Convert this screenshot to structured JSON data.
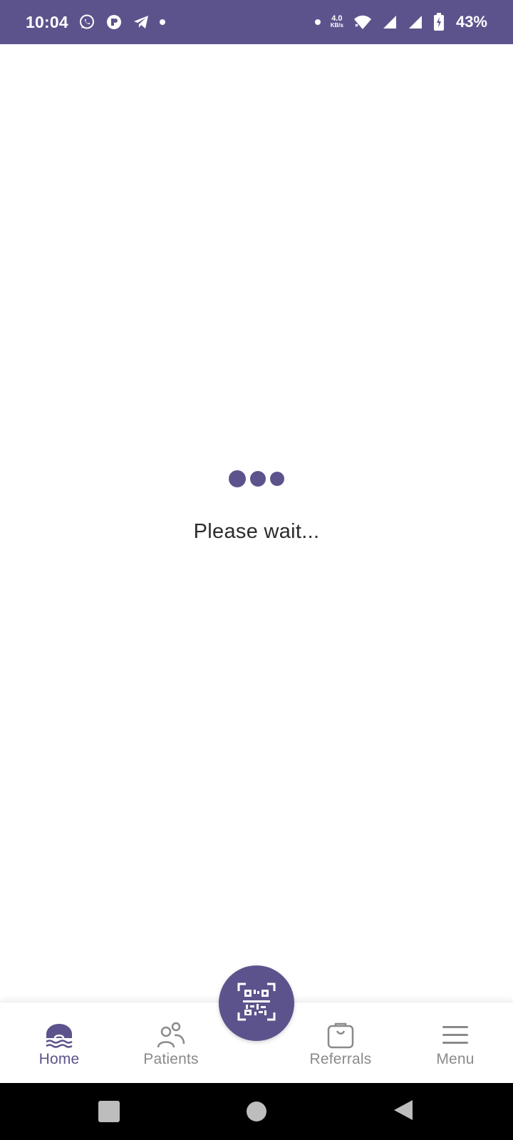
{
  "status_bar": {
    "time": "10:04",
    "net_speed_value": "4.0",
    "net_speed_unit": "KB/s",
    "battery_percent": "43%",
    "bar_color": "#5d538c",
    "left_icons": [
      "whatsapp-icon",
      "app-icon",
      "telegram-icon",
      "notification-dot-icon"
    ],
    "right_icons": [
      "dot-icon",
      "wifi-icon",
      "signal-icon",
      "signal-icon",
      "battery-charging-icon"
    ]
  },
  "loading": {
    "text": "Please wait..."
  },
  "bottom_nav": {
    "items": [
      {
        "label": "Home",
        "icon": "home-icon",
        "active": true
      },
      {
        "label": "Patients",
        "icon": "patients-icon",
        "active": false
      },
      {
        "label": "Referrals",
        "icon": "referrals-icon",
        "active": false
      },
      {
        "label": "Menu",
        "icon": "menu-icon",
        "active": false
      }
    ],
    "center_button_icon": "qr-scan-icon",
    "accent_color": "#5d538c",
    "inactive_color": "#8a8a8a"
  },
  "system_nav": {
    "buttons": [
      "recents-icon",
      "home-icon",
      "back-icon"
    ]
  }
}
